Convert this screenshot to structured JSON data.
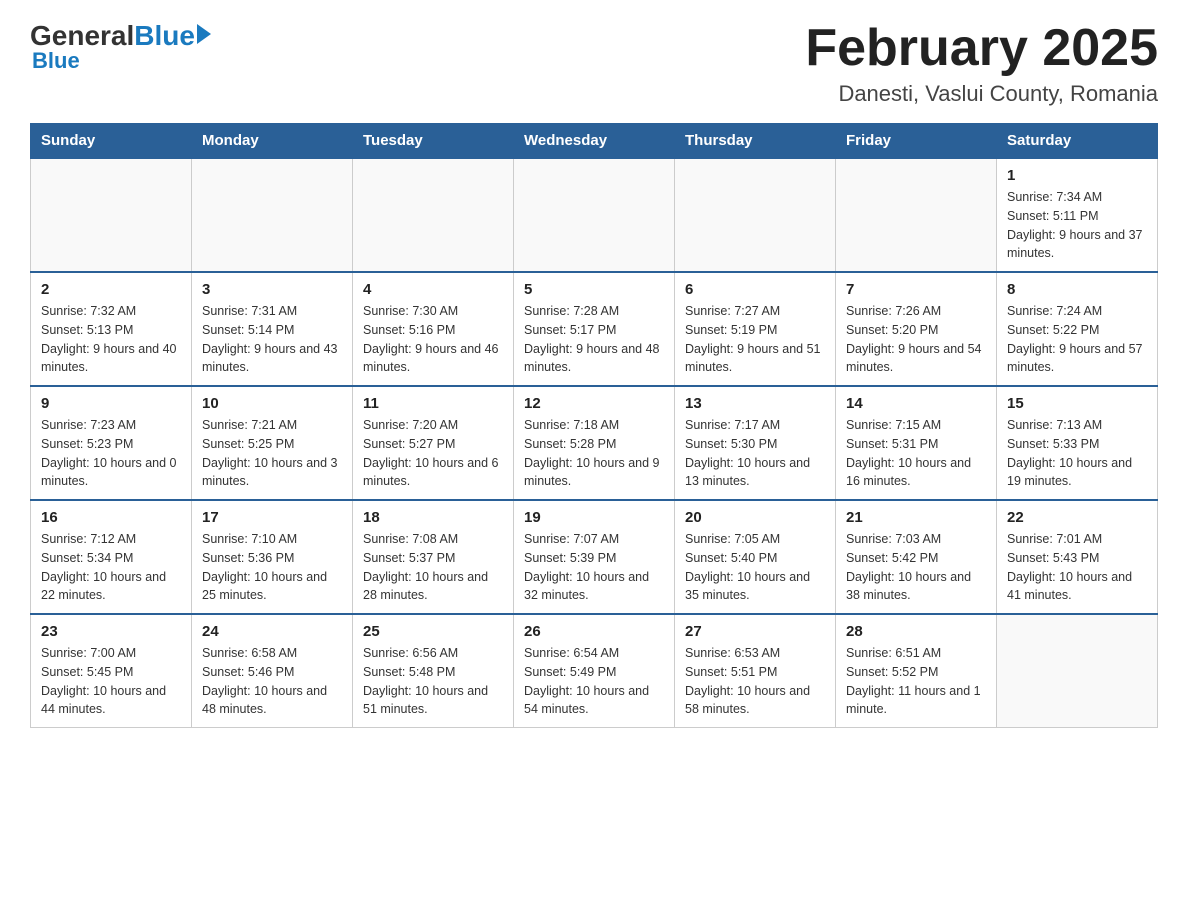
{
  "header": {
    "logo_general": "General",
    "logo_blue": "Blue",
    "title": "February 2025",
    "location": "Danesti, Vaslui County, Romania"
  },
  "days_of_week": [
    "Sunday",
    "Monday",
    "Tuesday",
    "Wednesday",
    "Thursday",
    "Friday",
    "Saturday"
  ],
  "weeks": [
    [
      {
        "day": "",
        "info": ""
      },
      {
        "day": "",
        "info": ""
      },
      {
        "day": "",
        "info": ""
      },
      {
        "day": "",
        "info": ""
      },
      {
        "day": "",
        "info": ""
      },
      {
        "day": "",
        "info": ""
      },
      {
        "day": "1",
        "info": "Sunrise: 7:34 AM\nSunset: 5:11 PM\nDaylight: 9 hours and 37 minutes."
      }
    ],
    [
      {
        "day": "2",
        "info": "Sunrise: 7:32 AM\nSunset: 5:13 PM\nDaylight: 9 hours and 40 minutes."
      },
      {
        "day": "3",
        "info": "Sunrise: 7:31 AM\nSunset: 5:14 PM\nDaylight: 9 hours and 43 minutes."
      },
      {
        "day": "4",
        "info": "Sunrise: 7:30 AM\nSunset: 5:16 PM\nDaylight: 9 hours and 46 minutes."
      },
      {
        "day": "5",
        "info": "Sunrise: 7:28 AM\nSunset: 5:17 PM\nDaylight: 9 hours and 48 minutes."
      },
      {
        "day": "6",
        "info": "Sunrise: 7:27 AM\nSunset: 5:19 PM\nDaylight: 9 hours and 51 minutes."
      },
      {
        "day": "7",
        "info": "Sunrise: 7:26 AM\nSunset: 5:20 PM\nDaylight: 9 hours and 54 minutes."
      },
      {
        "day": "8",
        "info": "Sunrise: 7:24 AM\nSunset: 5:22 PM\nDaylight: 9 hours and 57 minutes."
      }
    ],
    [
      {
        "day": "9",
        "info": "Sunrise: 7:23 AM\nSunset: 5:23 PM\nDaylight: 10 hours and 0 minutes."
      },
      {
        "day": "10",
        "info": "Sunrise: 7:21 AM\nSunset: 5:25 PM\nDaylight: 10 hours and 3 minutes."
      },
      {
        "day": "11",
        "info": "Sunrise: 7:20 AM\nSunset: 5:27 PM\nDaylight: 10 hours and 6 minutes."
      },
      {
        "day": "12",
        "info": "Sunrise: 7:18 AM\nSunset: 5:28 PM\nDaylight: 10 hours and 9 minutes."
      },
      {
        "day": "13",
        "info": "Sunrise: 7:17 AM\nSunset: 5:30 PM\nDaylight: 10 hours and 13 minutes."
      },
      {
        "day": "14",
        "info": "Sunrise: 7:15 AM\nSunset: 5:31 PM\nDaylight: 10 hours and 16 minutes."
      },
      {
        "day": "15",
        "info": "Sunrise: 7:13 AM\nSunset: 5:33 PM\nDaylight: 10 hours and 19 minutes."
      }
    ],
    [
      {
        "day": "16",
        "info": "Sunrise: 7:12 AM\nSunset: 5:34 PM\nDaylight: 10 hours and 22 minutes."
      },
      {
        "day": "17",
        "info": "Sunrise: 7:10 AM\nSunset: 5:36 PM\nDaylight: 10 hours and 25 minutes."
      },
      {
        "day": "18",
        "info": "Sunrise: 7:08 AM\nSunset: 5:37 PM\nDaylight: 10 hours and 28 minutes."
      },
      {
        "day": "19",
        "info": "Sunrise: 7:07 AM\nSunset: 5:39 PM\nDaylight: 10 hours and 32 minutes."
      },
      {
        "day": "20",
        "info": "Sunrise: 7:05 AM\nSunset: 5:40 PM\nDaylight: 10 hours and 35 minutes."
      },
      {
        "day": "21",
        "info": "Sunrise: 7:03 AM\nSunset: 5:42 PM\nDaylight: 10 hours and 38 minutes."
      },
      {
        "day": "22",
        "info": "Sunrise: 7:01 AM\nSunset: 5:43 PM\nDaylight: 10 hours and 41 minutes."
      }
    ],
    [
      {
        "day": "23",
        "info": "Sunrise: 7:00 AM\nSunset: 5:45 PM\nDaylight: 10 hours and 44 minutes."
      },
      {
        "day": "24",
        "info": "Sunrise: 6:58 AM\nSunset: 5:46 PM\nDaylight: 10 hours and 48 minutes."
      },
      {
        "day": "25",
        "info": "Sunrise: 6:56 AM\nSunset: 5:48 PM\nDaylight: 10 hours and 51 minutes."
      },
      {
        "day": "26",
        "info": "Sunrise: 6:54 AM\nSunset: 5:49 PM\nDaylight: 10 hours and 54 minutes."
      },
      {
        "day": "27",
        "info": "Sunrise: 6:53 AM\nSunset: 5:51 PM\nDaylight: 10 hours and 58 minutes."
      },
      {
        "day": "28",
        "info": "Sunrise: 6:51 AM\nSunset: 5:52 PM\nDaylight: 11 hours and 1 minute."
      },
      {
        "day": "",
        "info": ""
      }
    ]
  ]
}
